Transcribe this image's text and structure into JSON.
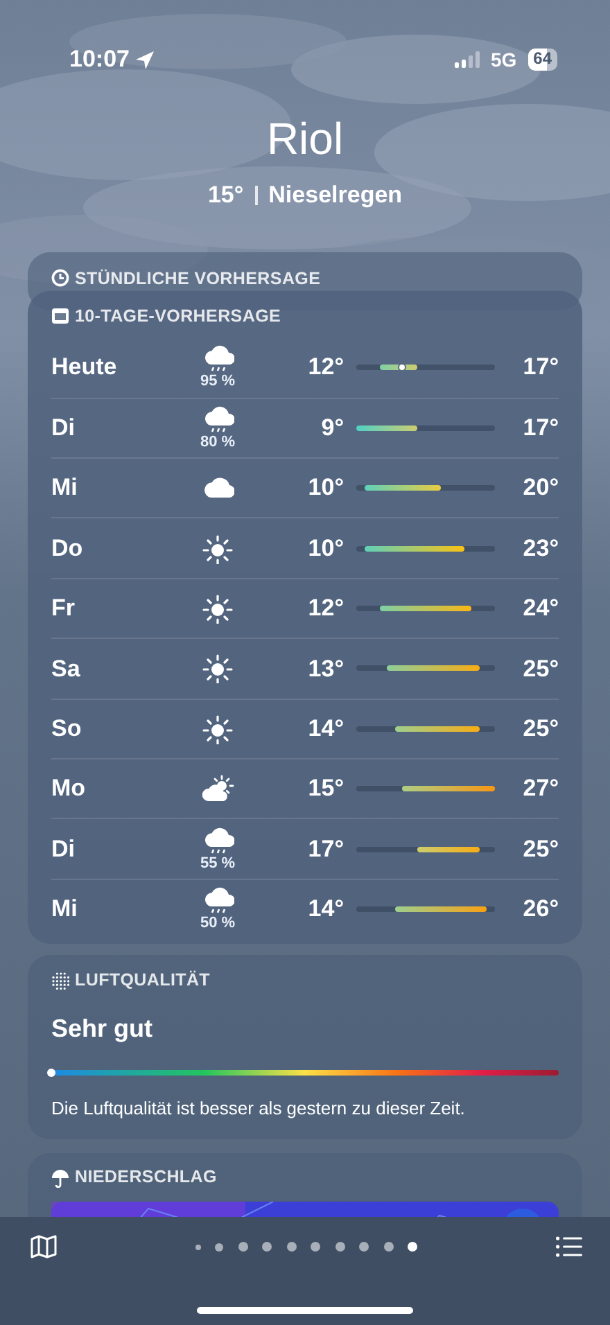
{
  "status_bar": {
    "time": "10:07",
    "network": "5G",
    "battery": "64"
  },
  "location": {
    "city": "Riol",
    "temperature": "15°",
    "condition": "Nieselregen"
  },
  "hourly": {
    "title": "STÜNDLICHE VORHERSAGE"
  },
  "ten_day": {
    "title": "10-TAGE-VORHERSAGE",
    "days": [
      {
        "day": "Heute",
        "kind": "rain",
        "precip": "95 %",
        "low": "12°",
        "high": "17°",
        "current_marker": true
      },
      {
        "day": "Di",
        "kind": "rain",
        "precip": "80 %",
        "low": "9°",
        "high": "17°",
        "current_marker": false
      },
      {
        "day": "Mi",
        "kind": "cloud",
        "low": "10°",
        "high": "20°",
        "current_marker": false
      },
      {
        "day": "Do",
        "kind": "sun",
        "low": "10°",
        "high": "23°",
        "current_marker": false
      },
      {
        "day": "Fr",
        "kind": "sun",
        "low": "12°",
        "high": "24°",
        "current_marker": false
      },
      {
        "day": "Sa",
        "kind": "sun",
        "low": "13°",
        "high": "25°",
        "current_marker": false
      },
      {
        "day": "So",
        "kind": "sun",
        "low": "14°",
        "high": "25°",
        "current_marker": false
      },
      {
        "day": "Mo",
        "kind": "partly",
        "low": "15°",
        "high": "27°",
        "current_marker": false
      },
      {
        "day": "Di",
        "kind": "rain",
        "precip": "55 %",
        "low": "17°",
        "high": "25°",
        "current_marker": false
      },
      {
        "day": "Mi",
        "kind": "rain",
        "precip": "50 %",
        "low": "14°",
        "high": "26°",
        "current_marker": false
      }
    ]
  },
  "air_quality": {
    "title": "LUFTQUALITÄT",
    "rating": "Sehr gut",
    "level": 0,
    "description": "Die Luftqualität ist besser als gestern zu dieser Zeit."
  },
  "precipitation": {
    "title": "NIEDERSCHLAG"
  },
  "page_dots": [
    {
      "selected": false
    },
    {
      "selected": false
    },
    {
      "selected": false
    },
    {
      "selected": false
    },
    {
      "selected": false
    },
    {
      "selected": false
    },
    {
      "selected": false
    },
    {
      "selected": false
    },
    {
      "selected": false
    },
    {
      "selected": true
    }
  ]
}
